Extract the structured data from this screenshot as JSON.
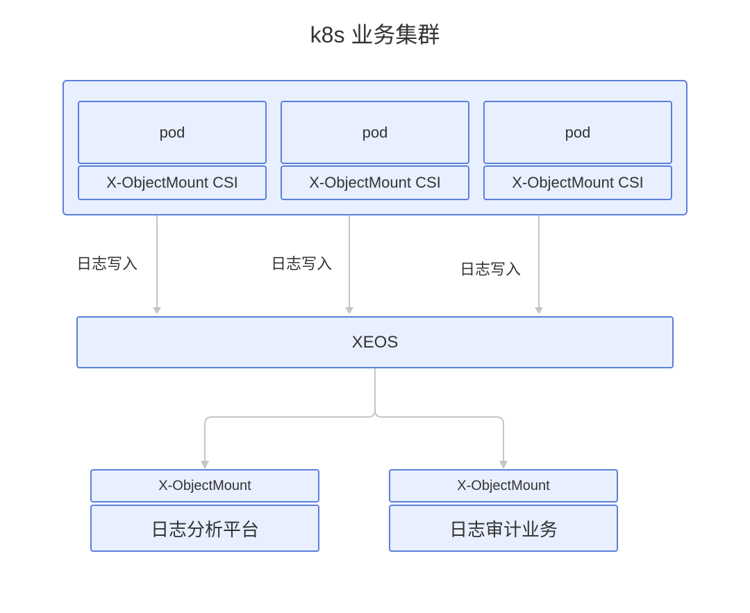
{
  "title": "k8s 业务集群",
  "cluster": {
    "pods": [
      {
        "label": "pod",
        "csi": "X-ObjectMount CSI"
      },
      {
        "label": "pod",
        "csi": "X-ObjectMount CSI"
      },
      {
        "label": "pod",
        "csi": "X-ObjectMount CSI"
      }
    ]
  },
  "arrow_labels": {
    "a1": "日志写入",
    "a2": "日志写入",
    "a3": "日志写入"
  },
  "xeos": "XEOS",
  "bottom": {
    "left": {
      "mount": "X-ObjectMount",
      "platform": "日志分析平台"
    },
    "right": {
      "mount": "X-ObjectMount",
      "platform": "日志审计业务"
    }
  }
}
